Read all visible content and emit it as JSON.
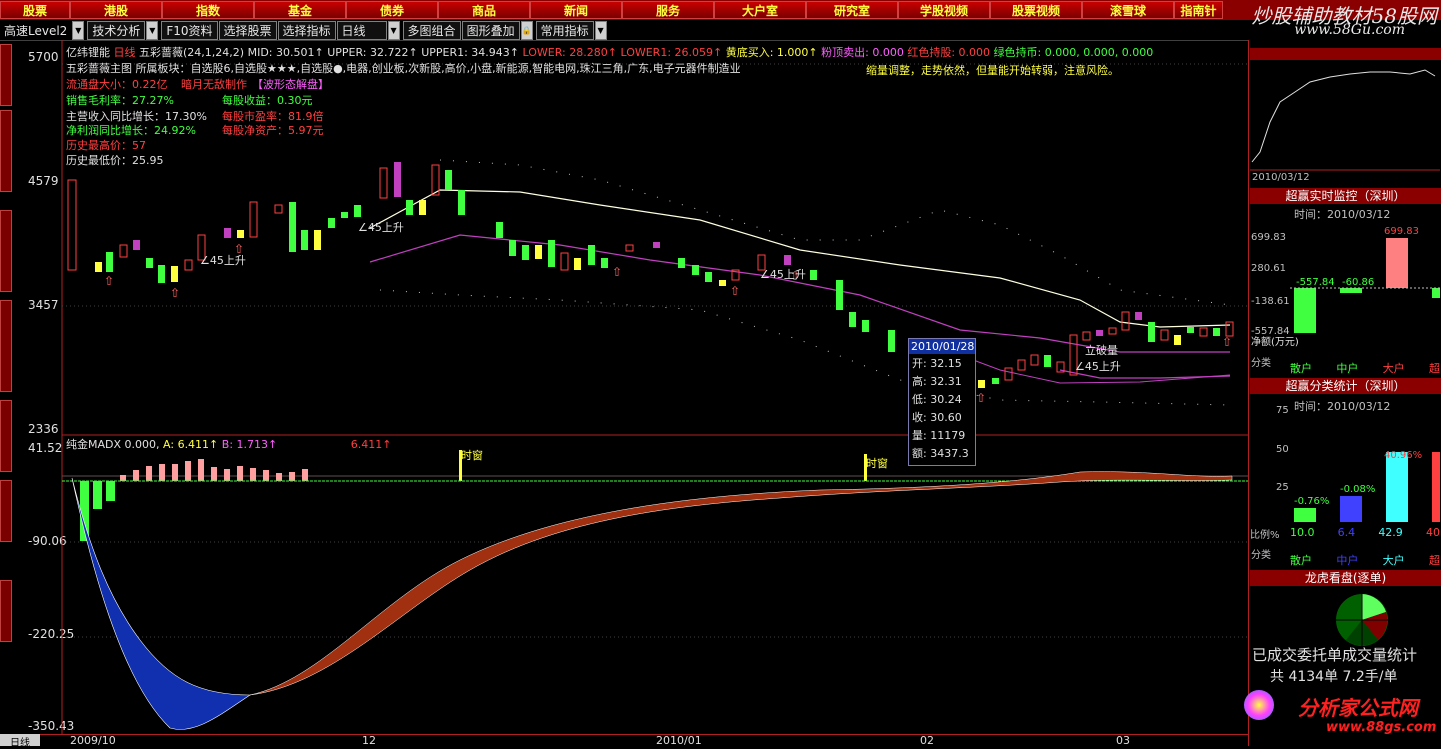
{
  "nav": [
    "股票",
    "港股",
    "指数",
    "基金",
    "债券",
    "商品",
    "新闻",
    "服务",
    "大户室",
    "研究室",
    "学股视频",
    "股票视频",
    "滚雪球",
    "指南针"
  ],
  "brand": {
    "title": "炒股辅助教材58股网",
    "url": "www.58Gu.com"
  },
  "toolbar": {
    "account": "高速Level2",
    "items": [
      "技术分析",
      "F10资料",
      "选择股票",
      "选择指标",
      "日线",
      "多图组合",
      "图形叠加",
      "常用指标"
    ]
  },
  "stock": {
    "name": "亿纬锂能",
    "indicator_header": "五彩蔷薇(24,1,24,2)",
    "mid": "MID: 30.501↑",
    "upper": "UPPER: 32.722↑",
    "upper1": "UPPER1: 34.943↑",
    "lower": "LOWER: 28.280↑",
    "lower1": "LOWER1: 26.059↑",
    "buy": "黄底买入: 1.000↑",
    "sell": "粉顶卖出: 0.000",
    "red": "红色持股: 0.000",
    "green": "绿色持币: 0.000, 0.000, 0.000",
    "line2": "五彩蔷薇主图  所属板块：自选股6,自选股★★★,自选股●,电器,创业板,次新股,高价,小盘,新能源,智能电网,珠江三角,广东,电子元器件制造业",
    "line3a": "流通盘大小：0.22亿",
    "line3b": "暗月无敌制作",
    "line3c": "【波形态解盘】",
    "note": "缩量调整，走势依然，但量能开始转弱，注意风险。",
    "stats": [
      {
        "label": "销售毛利率：27.27%",
        "color": "#40ff40"
      },
      {
        "label": "每股收益：0.30元",
        "color": "#40ff40"
      },
      {
        "label": "主营收入同比增长：17.30%",
        "color": "#e0e0e0"
      },
      {
        "label": "每股市盈率：81.9倍",
        "color": "#ff4040"
      },
      {
        "label": "净利润同比增长：24.92%",
        "color": "#40ff40"
      },
      {
        "label": "每股净资产：5.97元",
        "color": "#ff4040"
      },
      {
        "label": "历史最高价：57",
        "color": "#ff4040"
      },
      {
        "label": "历史最低价：25.95",
        "color": "#e0e0e0"
      }
    ]
  },
  "price_axis": [
    "5700",
    "4579",
    "3457",
    "2336"
  ],
  "sub_axis": [
    "41.52",
    "-90.06",
    "-220.25",
    "-350.43"
  ],
  "annotations": [
    "∠45上升",
    "∠45上升",
    "∠45上升",
    "立破量",
    "∠45上升"
  ],
  "sub_header": {
    "name": "纯金MADX",
    "v0": "0.000,",
    "a": "A: 6.411↑",
    "b": "B: 1.713↑",
    "c": "6.411↑"
  },
  "shikuang": "时窗",
  "tooltip": {
    "date": "2010/01/28",
    "rows": [
      "开: 32.15",
      "高: 32.31",
      "低: 30.24",
      "收: 30.60",
      "量: 11179",
      "额: 3437.3"
    ]
  },
  "x_axis": [
    "2009/10",
    "12",
    "2010/01",
    "02",
    "03"
  ],
  "bottom_tab": "日线",
  "right": {
    "mini_date": "2010/03/12",
    "p1_title": "超赢实时监控（深圳）",
    "p1_time": "时间：2010/03/12",
    "p1_axis": [
      "699.83",
      "280.61",
      "-138.61",
      "-557.84"
    ],
    "p1_values": [
      "-557.84",
      "-60.86",
      "699.83"
    ],
    "p1_label": "净额(万元)",
    "cat_label": "分类",
    "cats": [
      "散户",
      "中户",
      "大户",
      "超"
    ],
    "p2_title": "超赢分类统计（深圳）",
    "p2_time": "时间：2010/03/12",
    "p2_axis": [
      "75",
      "50",
      "25"
    ],
    "p2_values": [
      "-0.76%",
      "-0.08%",
      "40.96%"
    ],
    "ratio_label": "比例%",
    "ratio_values": [
      "10.0",
      "6.4",
      "42.9",
      "40"
    ],
    "p3_title": "龙虎看盘(逐单)",
    "p3_text": "已成交委托单成交量统计",
    "p3_total": "共 4134单  7.2手/单",
    "footer_logo": "分析家公式网",
    "footer_url": "www.88gs.com"
  }
}
